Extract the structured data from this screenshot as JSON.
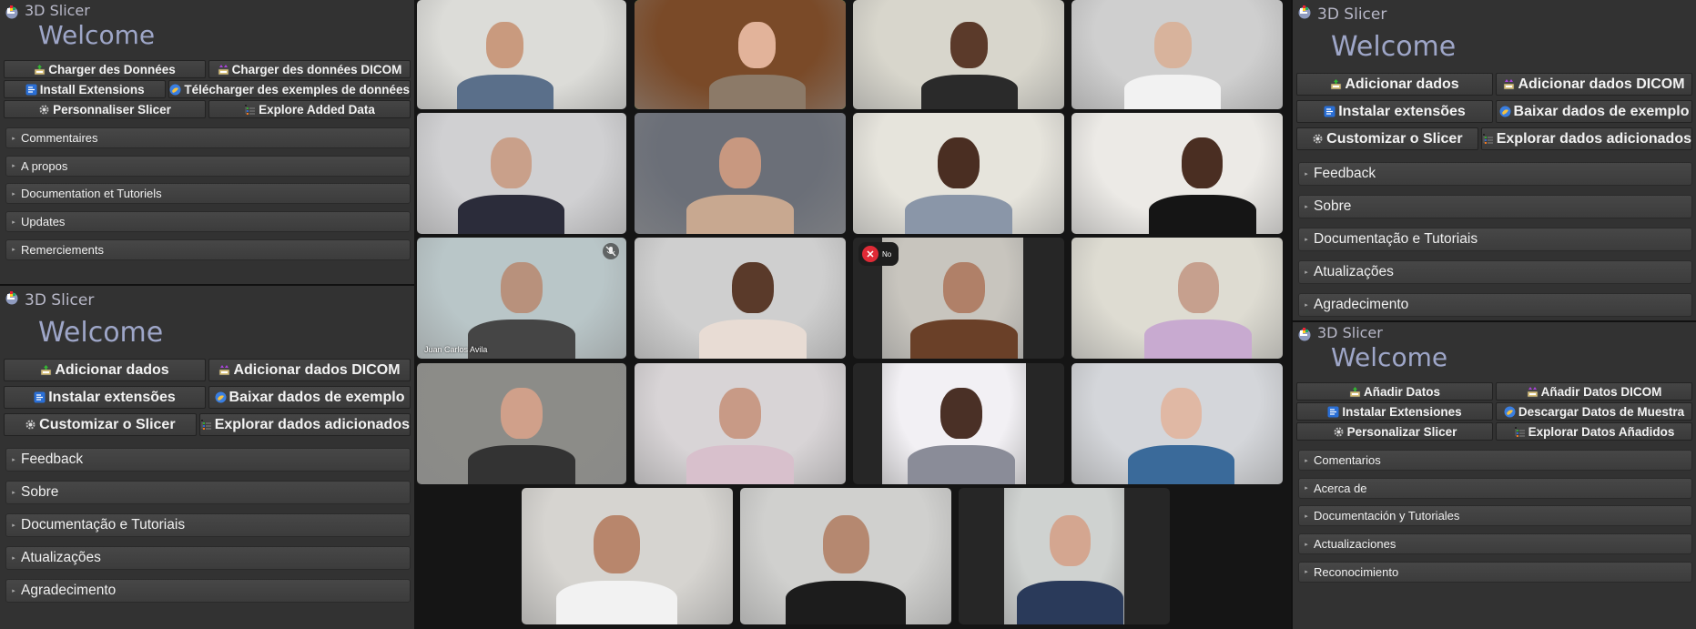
{
  "panels": {
    "left_top": {
      "app_name": "3D Slicer",
      "welcome": "Welcome",
      "buttons": [
        [
          "Charger des Données",
          "Charger des données DICOM"
        ],
        [
          "Install Extensions",
          "Télécharger des exemples de données"
        ],
        [
          "Personnaliser Slicer",
          "Explore Added Data"
        ]
      ],
      "sections": [
        "Commentaires",
        "A propos",
        "Documentation et Tutoriels",
        "Updates",
        "Remerciements"
      ]
    },
    "left_bottom": {
      "app_name": "3D Slicer",
      "welcome": "Welcome",
      "buttons": [
        [
          "Adicionar dados",
          "Adicionar dados DICOM"
        ],
        [
          "Instalar extensões",
          "Baixar dados de exemplo"
        ],
        [
          "Customizar o Slicer",
          "Explorar dados adicionados"
        ]
      ],
      "sections": [
        "Feedback",
        "Sobre",
        "Documentação e Tutoriais",
        "Atualizações",
        "Agradecimento"
      ]
    },
    "right_top": {
      "app_name": "3D Slicer",
      "welcome": "Welcome",
      "buttons": [
        [
          "Adicionar dados",
          "Adicionar dados DICOM"
        ],
        [
          "Instalar extensões",
          "Baixar dados de exemplo"
        ],
        [
          "Customizar o Slicer",
          "Explorar dados adicionados"
        ]
      ],
      "sections": [
        "Feedback",
        "Sobre",
        "Documentação e Tutoriais",
        "Atualizações",
        "Agradecimento"
      ]
    },
    "right_bottom": {
      "app_name": "3D Slicer",
      "welcome": "Welcome",
      "buttons": [
        [
          "Añadir Datos",
          "Añadir Datos DICOM"
        ],
        [
          "Instalar Extensiones",
          "Descargar Datos de Muestra"
        ],
        [
          "Personalizar Slicer",
          "Explorar Datos Añadidos"
        ]
      ],
      "sections": [
        "Comentarios",
        "Acerca de",
        "Documentación y Tutoriales",
        "Actualizaciones",
        "Reconocimiento"
      ]
    }
  },
  "button_icons": [
    [
      "load-data-icon",
      "load-dicom-icon"
    ],
    [
      "extensions-icon",
      "sample-data-icon"
    ],
    [
      "customize-gear-icon",
      "explore-data-icon"
    ]
  ],
  "video_call": {
    "active_speaker_color": "#3ad44a",
    "participants": [
      {
        "row": 0,
        "col": 0,
        "label": "",
        "active": false
      },
      {
        "row": 0,
        "col": 1,
        "label": "",
        "active": true
      },
      {
        "row": 0,
        "col": 2,
        "label": "",
        "active": false
      },
      {
        "row": 0,
        "col": 3,
        "label": "",
        "active": false
      },
      {
        "row": 1,
        "col": 0,
        "label": "",
        "active": false
      },
      {
        "row": 1,
        "col": 1,
        "label": "",
        "active": false
      },
      {
        "row": 1,
        "col": 2,
        "label": "",
        "active": false
      },
      {
        "row": 1,
        "col": 3,
        "label": "",
        "active": false
      },
      {
        "row": 2,
        "col": 0,
        "label": "Juan Carlos Avila",
        "active": false,
        "muted": true
      },
      {
        "row": 2,
        "col": 1,
        "label": "",
        "active": false
      },
      {
        "row": 2,
        "col": 2,
        "label": "",
        "active": false,
        "reaction": "No"
      },
      {
        "row": 2,
        "col": 3,
        "label": "",
        "active": false
      },
      {
        "row": 3,
        "col": 0,
        "label": "",
        "active": false
      },
      {
        "row": 3,
        "col": 1,
        "label": "",
        "active": false
      },
      {
        "row": 3,
        "col": 2,
        "label": "",
        "active": false
      },
      {
        "row": 3,
        "col": 3,
        "label": "",
        "active": false
      },
      {
        "row": 4,
        "col": 0,
        "label": "",
        "active": false
      },
      {
        "row": 4,
        "col": 1,
        "label": "",
        "active": false
      },
      {
        "row": 4,
        "col": 2,
        "label": "",
        "active": false
      }
    ]
  }
}
